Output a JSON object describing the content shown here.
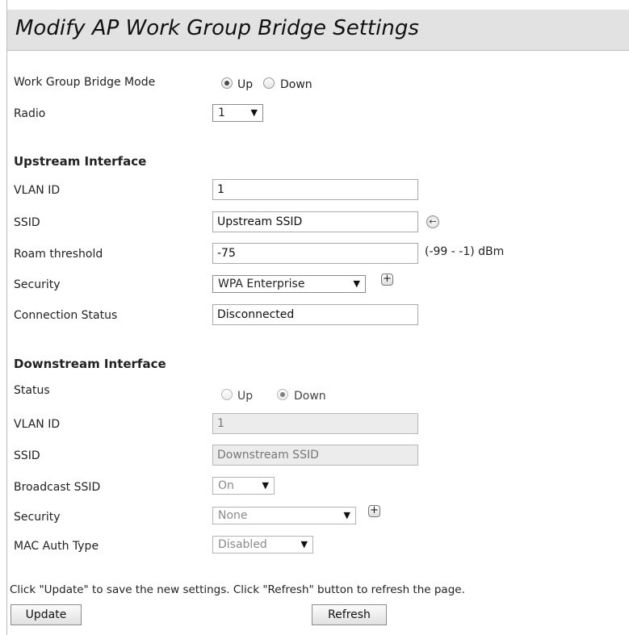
{
  "title": "Modify AP Work Group Bridge Settings",
  "general": {
    "wgb_mode_label": "Work Group Bridge Mode",
    "mode_options": [
      "Up",
      "Down"
    ],
    "mode_selected": "Up",
    "radio_label": "Radio",
    "radio_value": "1"
  },
  "upstream": {
    "heading": "Upstream Interface",
    "vlan_label": "VLAN ID",
    "vlan_value": "1",
    "ssid_label": "SSID",
    "ssid_value": "Upstream SSID",
    "ssid_button_icon": "arrow-left-icon",
    "roam_label": "Roam threshold",
    "roam_value": "-75",
    "roam_unit": "(-99 - -1) dBm",
    "security_label": "Security",
    "security_value": "WPA Enterprise",
    "connection_label": "Connection Status",
    "connection_value": "Disconnected"
  },
  "downstream": {
    "heading": "Downstream Interface",
    "status_label": "Status",
    "status_options": [
      "Up",
      "Down"
    ],
    "status_selected": "Down",
    "vlan_label": "VLAN ID",
    "vlan_value": "1",
    "ssid_label": "SSID",
    "ssid_value": "Downstream SSID",
    "broadcast_label": "Broadcast SSID",
    "broadcast_value": "On",
    "security_label": "Security",
    "security_value": "None",
    "mac_auth_label": "MAC Auth Type",
    "mac_auth_value": "Disabled"
  },
  "footer": {
    "note": "Click \"Update\" to save the new settings. Click \"Refresh\" button to refresh the page.",
    "update_label": "Update",
    "refresh_label": "Refresh"
  },
  "colors": {
    "title_bar": "#e2e2e2",
    "disabled_field": "#ececec"
  }
}
